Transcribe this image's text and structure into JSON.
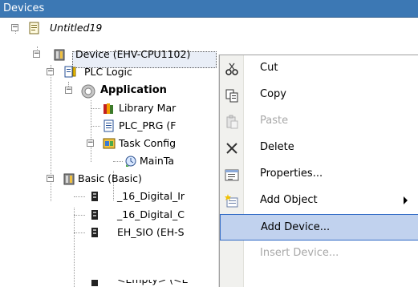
{
  "panel": {
    "title": "Devices"
  },
  "tree": {
    "project": "Untitled19",
    "device": "Device (EHV-CPU1102)",
    "plc_logic": "PLC Logic",
    "application": "Application",
    "library_manager": "Library Mar",
    "plc_prg": "PLC_PRG (F",
    "task_config": "Task Config",
    "main_task": "MainTa",
    "basic": "Basic (Basic)",
    "digital_in": "_16_Digital_Ir",
    "digital_out": "_16_Digital_C",
    "eh_sio": "EH_SIO (EH-S",
    "empty": "<Empty> (<E"
  },
  "context_menu": {
    "items": [
      {
        "label": "Cut",
        "icon": "scissors-icon",
        "state": "enabled"
      },
      {
        "label": "Copy",
        "icon": "copy-icon",
        "state": "enabled"
      },
      {
        "label": "Paste",
        "icon": "paste-icon",
        "state": "disabled"
      },
      {
        "label": "Delete",
        "icon": "delete-icon",
        "state": "enabled"
      },
      {
        "label": "Properties...",
        "icon": "properties-icon",
        "state": "enabled"
      },
      {
        "label": "Add Object",
        "icon": "add-object-icon",
        "state": "enabled",
        "submenu": true
      },
      {
        "label": "Add Device...",
        "icon": "",
        "state": "hover"
      },
      {
        "label": "Insert Device...",
        "icon": "",
        "state": "disabled"
      }
    ]
  },
  "colors": {
    "title_bar": "#3c78b4",
    "menu_hover": "#c1d2ee",
    "menu_hover_border": "#316ac5",
    "disabled_text": "#a8a8a8"
  }
}
